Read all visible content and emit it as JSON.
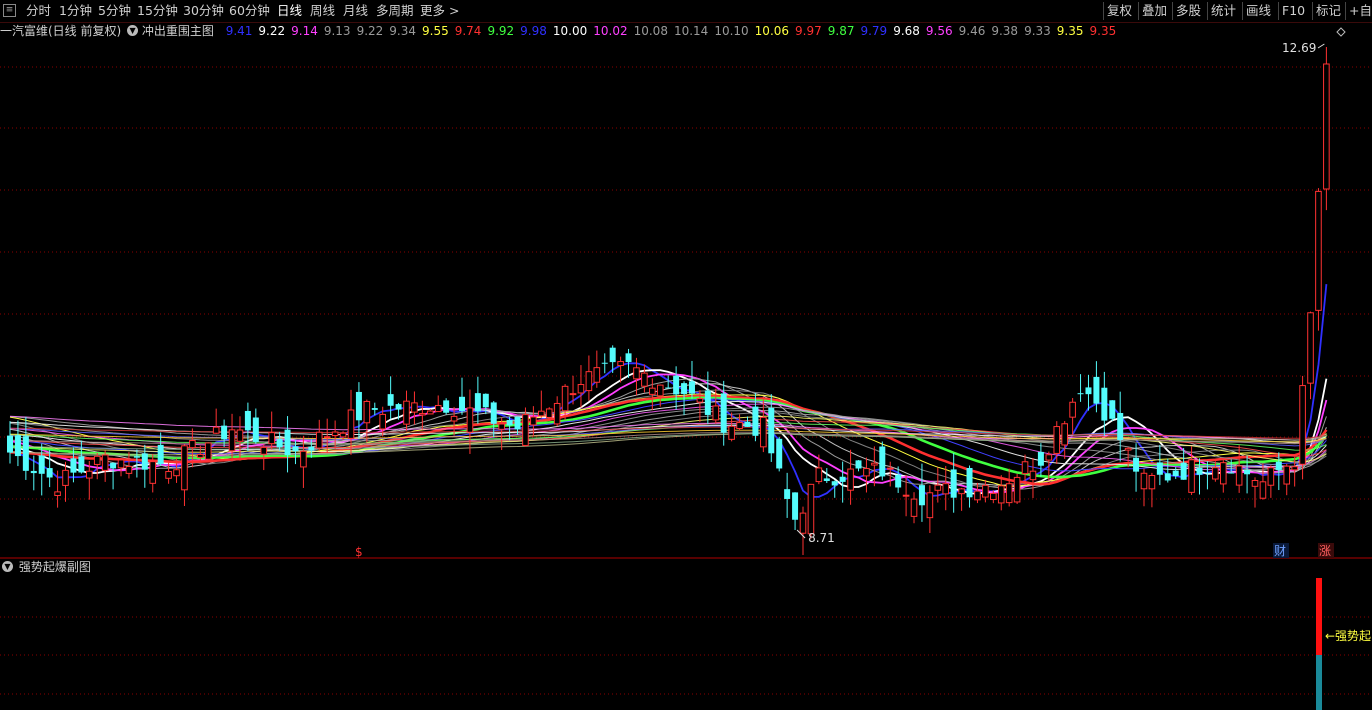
{
  "toolbar": {
    "periods": [
      "分时",
      "1分钟",
      "5分钟",
      "15分钟",
      "30分钟",
      "60分钟",
      "日线",
      "周线",
      "月线",
      "多周期",
      "更多 >"
    ],
    "active_period": "日线",
    "right_buttons": [
      "复权",
      "叠加",
      "多股",
      "统计",
      "画线",
      "F10",
      "标记",
      "+自选"
    ]
  },
  "main_panel": {
    "stock_title": "一汽富维(日线 前复权)",
    "indicator_name": "冲出重围主图",
    "ma_values": [
      {
        "v": "9.41",
        "color": "#3030ff"
      },
      {
        "v": "9.22",
        "color": "#ffffff"
      },
      {
        "v": "9.14",
        "color": "#ff40ff"
      },
      {
        "v": "9.13",
        "color": "#9a9a9a"
      },
      {
        "v": "9.22",
        "color": "#9a9a9a"
      },
      {
        "v": "9.34",
        "color": "#9a9a9a"
      },
      {
        "v": "9.55",
        "color": "#ffff40"
      },
      {
        "v": "9.74",
        "color": "#ff3030"
      },
      {
        "v": "9.92",
        "color": "#40ff40"
      },
      {
        "v": "9.98",
        "color": "#3030ff"
      },
      {
        "v": "10.00",
        "color": "#ffffff"
      },
      {
        "v": "10.02",
        "color": "#ff40ff"
      },
      {
        "v": "10.08",
        "color": "#9a9a9a"
      },
      {
        "v": "10.14",
        "color": "#9a9a9a"
      },
      {
        "v": "10.10",
        "color": "#9a9a9a"
      },
      {
        "v": "10.06",
        "color": "#ffff40"
      },
      {
        "v": "9.97",
        "color": "#ff3030"
      },
      {
        "v": "9.87",
        "color": "#40ff40"
      },
      {
        "v": "9.79",
        "color": "#3030ff"
      },
      {
        "v": "9.68",
        "color": "#ffffff"
      },
      {
        "v": "9.56",
        "color": "#ff40ff"
      },
      {
        "v": "9.46",
        "color": "#9a9a9a"
      },
      {
        "v": "9.38",
        "color": "#9a9a9a"
      },
      {
        "v": "9.33",
        "color": "#9a9a9a"
      },
      {
        "v": "9.35",
        "color": "#ffff40"
      },
      {
        "v": "9.35",
        "color": "#ff3030"
      }
    ],
    "high_label": "12.69",
    "low_label": "8.71",
    "markers": {
      "dollar": "$",
      "cai": "财",
      "zhang": "涨"
    }
  },
  "sub_panel": {
    "indicator_name": "强势起爆副图",
    "signal_label": "←强势起"
  },
  "colors": {
    "up": "#ff3232",
    "down": "#54fcfc",
    "grid": "#8a0000",
    "separator": "#b00000"
  }
}
